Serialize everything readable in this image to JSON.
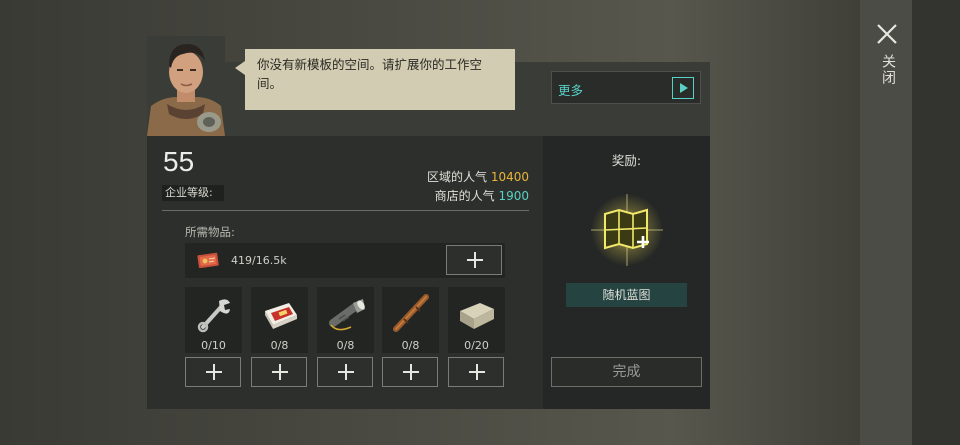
{
  "dialog": {
    "message": "你没有新模板的空间。请扩展你的工作空间。",
    "more_label": "更多",
    "close_label": "关闭"
  },
  "company": {
    "level": "55",
    "level_label": "企业等级:",
    "region_pop_label": "区域的人气",
    "region_pop_value": "10400",
    "shop_pop_label": "商店的人气",
    "shop_pop_value": "1900"
  },
  "requirements": {
    "label": "所需物品:",
    "resource": {
      "icon": "coupon-ticket-icon",
      "count": "419/16.5k"
    },
    "items": [
      {
        "icon": "wrench-icon",
        "count": "0/10"
      },
      {
        "icon": "cigarette-pack-icon",
        "count": "0/8"
      },
      {
        "icon": "flashlight-icon",
        "count": "0/8"
      },
      {
        "icon": "wooden-stick-icon",
        "count": "0/8"
      },
      {
        "icon": "stone-block-icon",
        "count": "0/20"
      }
    ]
  },
  "reward": {
    "title": "奖励:",
    "icon": "blueprint-map-icon",
    "name": "随机蓝图"
  },
  "actions": {
    "complete_label": "完成"
  },
  "colors": {
    "accent_cyan": "#58d2c7",
    "gold": "#e8b43a",
    "bubble": "#d2ccb3"
  }
}
